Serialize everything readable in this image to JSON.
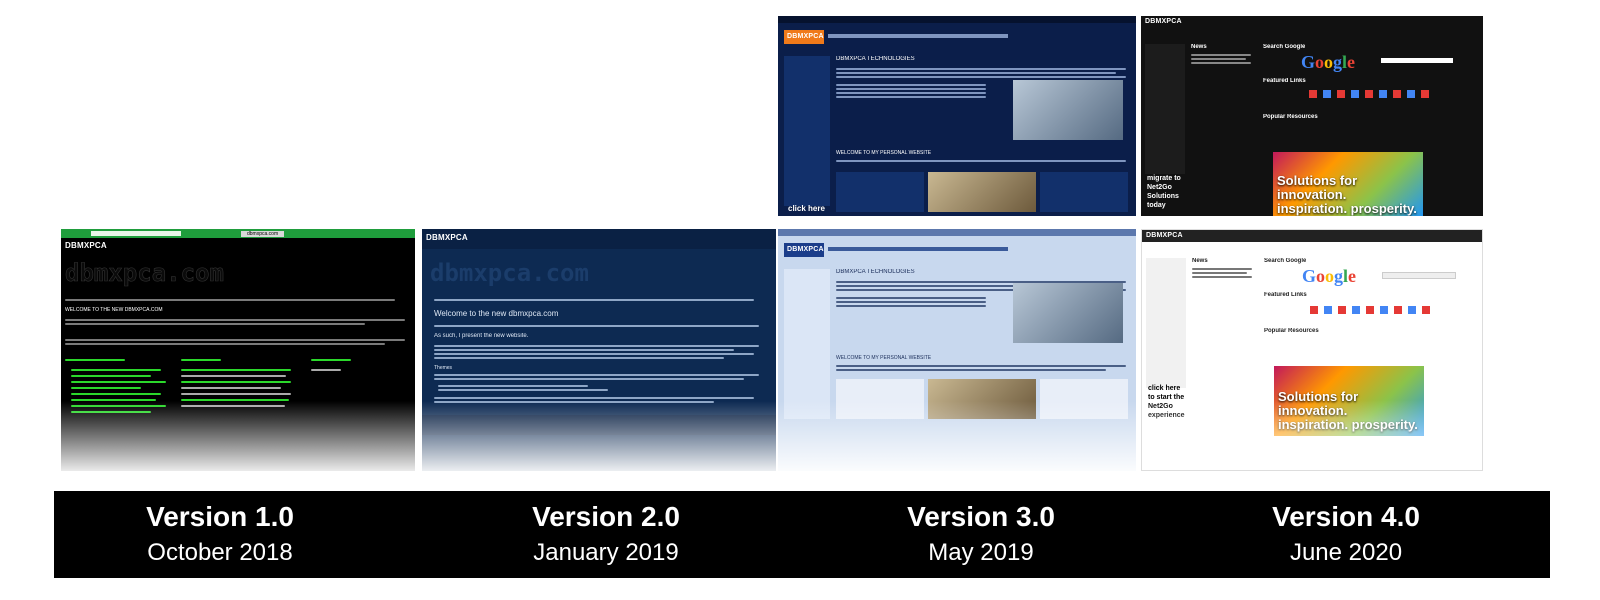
{
  "versions": [
    {
      "title": "Version 1.0",
      "date": "October 2018"
    },
    {
      "title": "Version 2.0",
      "date": "January 2019"
    },
    {
      "title": "Version 3.0",
      "date": "May 2019"
    },
    {
      "title": "Version 4.0",
      "date": "June 2020"
    }
  ],
  "shots": {
    "v1": {
      "logo": "DBMXPCA",
      "big": "dbmxpca.com",
      "browser_tab": "dbmxpca.com",
      "heading": "WELCOME TO THE NEW DBMXPCA.COM"
    },
    "v2": {
      "logo": "DBMXPCA",
      "big": "dbmxpca.com",
      "heading": "Welcome to the new dbmxpca.com",
      "subheading": "As such, I present the new website.",
      "themes": "Themes"
    },
    "v3": {
      "logo": "DBMXPCA",
      "heading": "DBMXPCA TECHNOLOGIES",
      "welcome": "WELCOME TO MY PERSONAL WEBSITE",
      "click": "click here"
    },
    "v3b": {
      "logo": "DBMXPCA",
      "heading": "DBMXPCA TECHNOLOGIES",
      "welcome": "WELCOME TO MY PERSONAL WEBSITE"
    },
    "v4": {
      "logo": "DBMXPCA",
      "news": "News",
      "search": "Search Google",
      "featured": "Featured Links",
      "resources": "Popular Resources",
      "ad": "Solutions for innovation. inspiration. prosperity.",
      "migrate": "migrate to Net2Go Solutions today"
    },
    "v4b": {
      "logo": "DBMXPCA",
      "news": "News",
      "search": "Search Google",
      "featured": "Featured Links",
      "resources": "Popular Resources",
      "ad": "Solutions for innovation. inspiration. prosperity.",
      "click": "click here to start the Net2Go experience"
    }
  },
  "colors": {
    "band": "#000000",
    "v1_bg": "#000000",
    "v1_text": "#2bd82b",
    "v2_bg": "#0d2a52",
    "v3_bg": "#0b1e4a",
    "v4_bg": "#111111"
  }
}
